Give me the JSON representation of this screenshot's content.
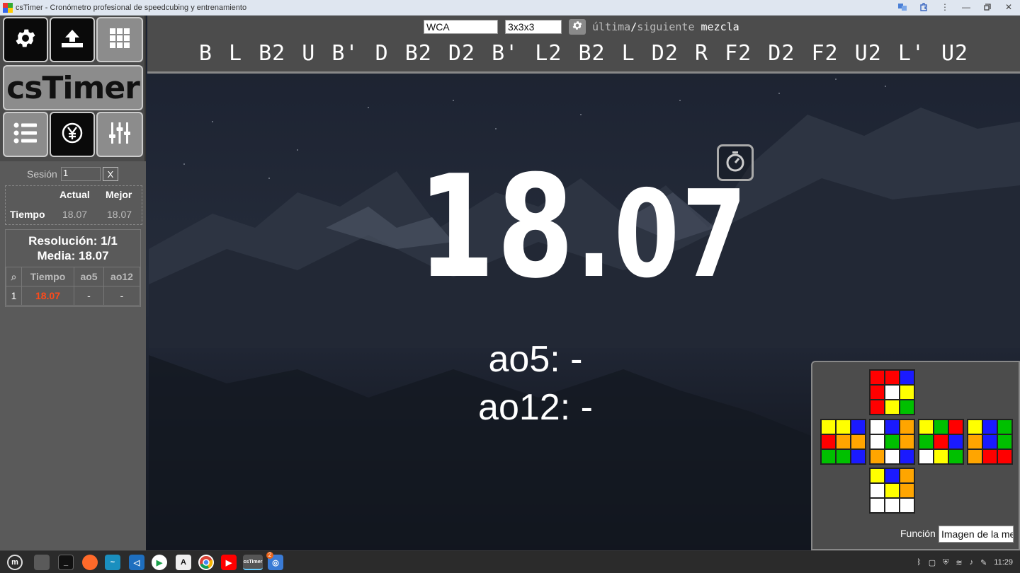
{
  "window": {
    "title": "csTimer - Cronómetro profesional de speedcubing y entrenamiento"
  },
  "sidebar": {
    "logo_text": "csTimer",
    "session_label": "Sesión",
    "session_value": "1",
    "session_clear": "X",
    "best": {
      "header_current": "Actual",
      "header_best": "Mejor",
      "row_label": "Tiempo",
      "current": "18.07",
      "best": "18.07"
    },
    "summary": {
      "solves": "Resolución: 1/1",
      "mean": "Media: 18.07"
    },
    "table": {
      "headers": [
        "⌕",
        "Tiempo",
        "ao5",
        "ao12"
      ],
      "rows": [
        {
          "n": "1",
          "time": "18.07",
          "ao5": "-",
          "ao12": "-"
        }
      ]
    }
  },
  "toolbar": {
    "event_type": "WCA",
    "puzzle": "3x3x3",
    "scramble_prev": "última",
    "scramble_sep": "/",
    "scramble_next_word": "siguiente",
    "scramble_mezcla": "mezcla",
    "scramble": "B L B2 U B' D B2 D2 B' L2 B2 L D2 R F2 D2 F2 U2 L' U2"
  },
  "timer": {
    "whole": "18",
    "frac": ".07",
    "ao5": "ao5: -",
    "ao12": "ao12: -"
  },
  "cube_preview": {
    "function_label": "Función",
    "function_value": "Imagen de la mezcla",
    "colors": {
      "R": "#ff0000",
      "W": "#ffffff",
      "B": "#1a1aff",
      "Y": "#ffff00",
      "G": "#00c000",
      "O": "#ffa500"
    },
    "faces": {
      "U": [
        "R",
        "R",
        "B",
        "R",
        "W",
        "Y",
        "R",
        "Y",
        "G"
      ],
      "L": [
        "Y",
        "Y",
        "B",
        "R",
        "O",
        "O",
        "G",
        "G",
        "B"
      ],
      "F": [
        "W",
        "B",
        "O",
        "W",
        "G",
        "O",
        "O",
        "W",
        "B"
      ],
      "R": [
        "Y",
        "G",
        "R",
        "G",
        "R",
        "B",
        "W",
        "Y",
        "G"
      ],
      "B": [
        "Y",
        "B",
        "G",
        "O",
        "B",
        "G",
        "O",
        "R",
        "R"
      ],
      "D": [
        "Y",
        "B",
        "O",
        "W",
        "Y",
        "O",
        "W",
        "W",
        "W"
      ]
    }
  },
  "taskbar": {
    "clock": "11:29",
    "active_app_label": "csTimer",
    "badge": "2"
  }
}
